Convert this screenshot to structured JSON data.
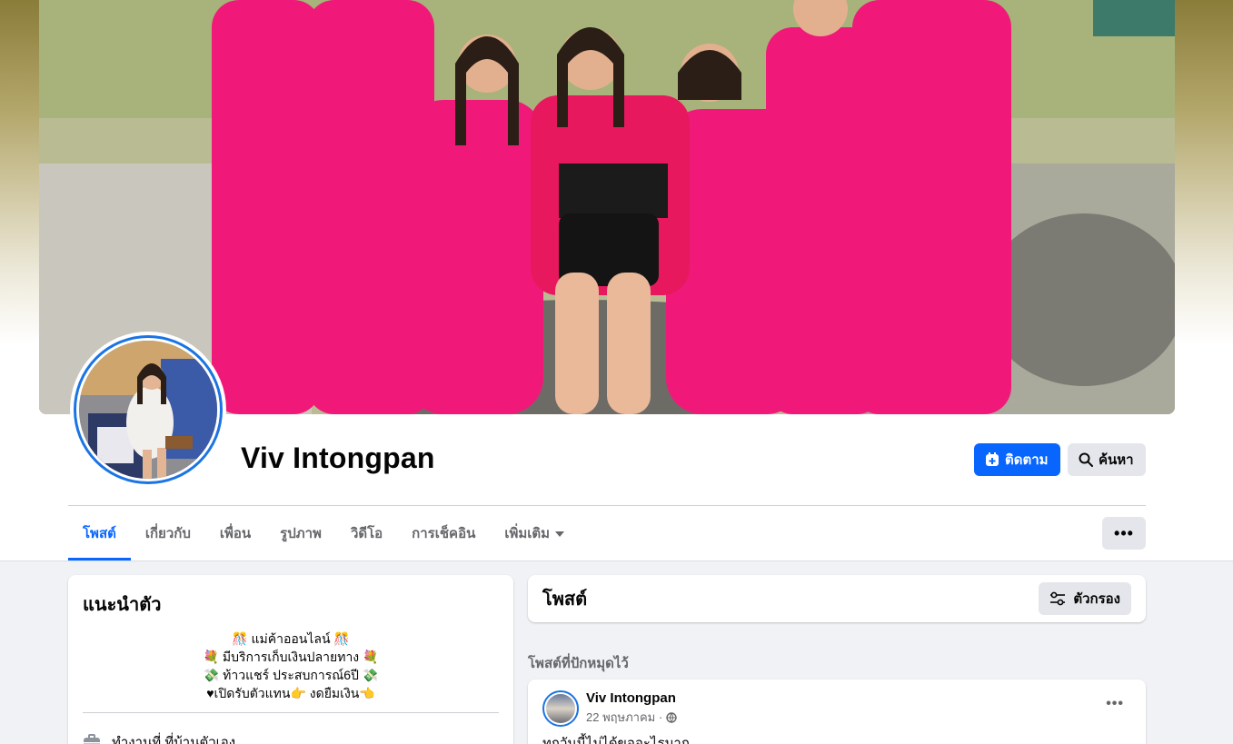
{
  "profile": {
    "name": "Viv Intongpan"
  },
  "actions": {
    "follow_label": "ติดตาม",
    "search_label": "ค้นหา"
  },
  "tabs": [
    {
      "label": "โพสต์"
    },
    {
      "label": "เกี่ยวกับ"
    },
    {
      "label": "เพื่อน"
    },
    {
      "label": "รูปภาพ"
    },
    {
      "label": "วิดีโอ"
    },
    {
      "label": "การเช็คอิน"
    },
    {
      "label": "เพิ่มเติม"
    }
  ],
  "intro": {
    "title": "แนะนำตัว",
    "bio_lines": [
      "🎊 แม่ค้าออนไลน์ 🎊",
      "💐 มีบริการเก็บเงินปลายทาง 💐",
      "💸 ท้าวแชร์ ประสบการณ์6ปี 💸",
      "♥เปิดรับตัวแทน👉 งดยืมเงิน👈"
    ],
    "work": "ทำงานที่ ที่บ้านตัวเอง"
  },
  "posts_section": {
    "title": "โพสต์",
    "filter_label": "ตัวกรอง",
    "pinned_label": "โพสต์ที่ปักหมุดไว้"
  },
  "post": {
    "author": "Viv Intongpan",
    "date": "22 พฤษภาคม ·",
    "text": "ทุกวันนี้ไม่ได้ขออะไรมาก"
  },
  "colors": {
    "accent": "#0866ff",
    "secondary_button": "#e4e6eb",
    "muted_text": "#65676b",
    "page_bg": "#f0f2f5"
  },
  "icons": {
    "follow": "add-follow-icon",
    "search": "search-icon",
    "more": "more-dots-icon",
    "filter": "filter-sliders-icon",
    "work": "briefcase-icon",
    "privacy": "globe-icon"
  }
}
